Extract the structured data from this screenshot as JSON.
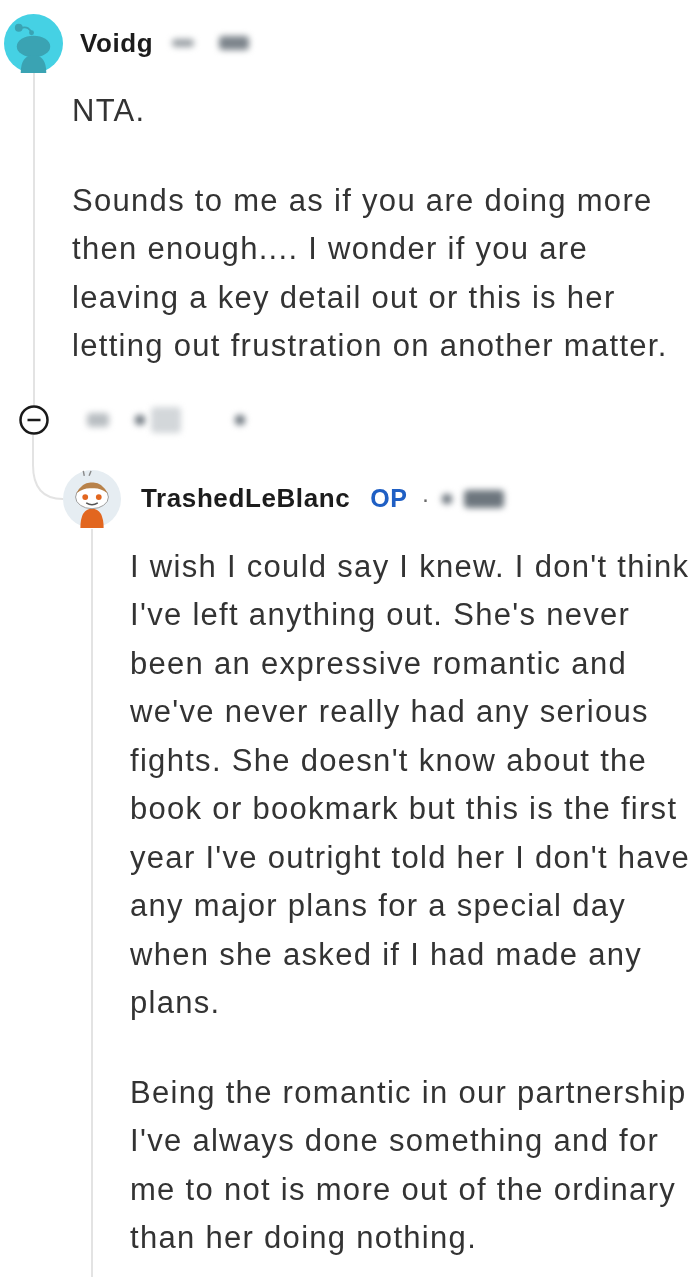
{
  "comment": {
    "author": "Voidg",
    "paragraphs": [
      "NTA.",
      "Sounds to me as if you are doing more then enough.... I wonder if you are leaving a key detail out or this is her letting out frustration on another matter."
    ],
    "expanded": true,
    "replies": [
      {
        "author": "TrashedLeBlanc",
        "badge": "OP",
        "separator": "·",
        "paragraphs": [
          "I wish I could say I knew. I don't think I've left anything out. She's never been an expressive romantic and we've never really had any serious fights. She doesn't know about the book or bookmark but this is the first year I've outright told her I don't have any major plans for a special day when she asked if I had made any plans.",
          "Being the romantic in our partnership I've always done something and for me to not is more out of the ordinary than her doing nothing."
        ]
      }
    ]
  }
}
